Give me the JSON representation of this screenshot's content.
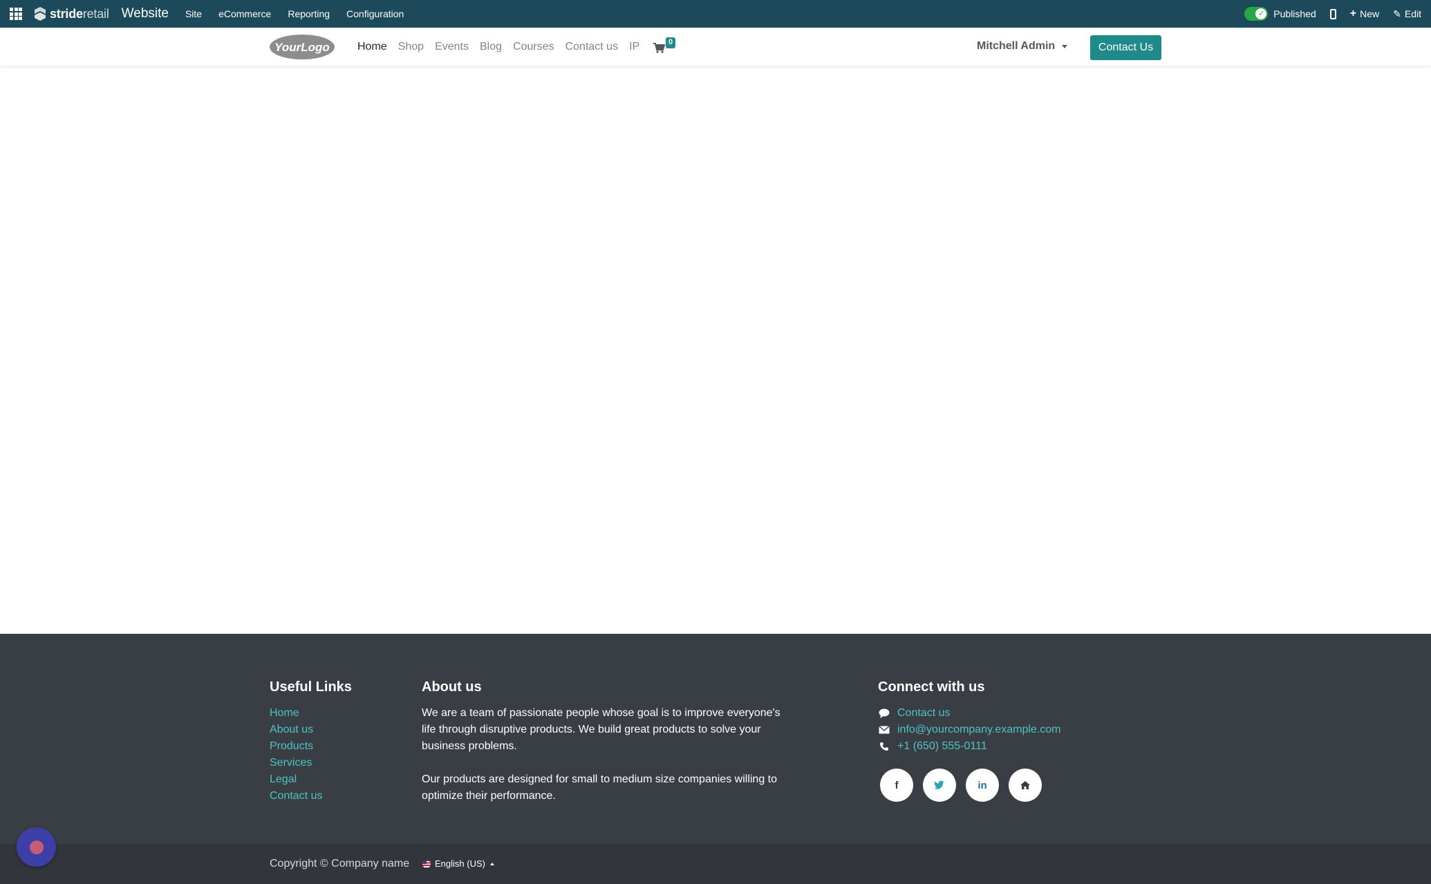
{
  "adminbar": {
    "brand_part1": "stride",
    "brand_part2": "retail",
    "app_name": "Website",
    "menu": [
      "Site",
      "eCommerce",
      "Reporting",
      "Configuration"
    ],
    "published_label": "Published",
    "new_label": "New",
    "edit_label": "Edit"
  },
  "header": {
    "logo_text": "YourLogo",
    "nav": [
      "Home",
      "Shop",
      "Events",
      "Blog",
      "Courses",
      "Contact us",
      "IP"
    ],
    "cart_count": "0",
    "user_name": "Mitchell Admin",
    "contact_button": "Contact Us"
  },
  "footer": {
    "useful_links_title": "Useful Links",
    "useful_links": [
      "Home",
      "About us",
      "Products",
      "Services",
      "Legal",
      "Contact us"
    ],
    "about_title": "About us",
    "about_p1": "We are a team of passionate people whose goal is to improve everyone's life through disruptive products. We build great products to solve your business problems.",
    "about_p2": "Our products are designed for small to medium size companies willing to optimize their performance.",
    "connect_title": "Connect with us",
    "connect_contact": "Contact us",
    "connect_email": "info@yourcompany.example.com",
    "connect_phone": "+1 (650) 555-0111",
    "socials": [
      "facebook-icon",
      "twitter-icon",
      "linkedin-icon",
      "home-icon"
    ]
  },
  "copyright": {
    "text": "Copyright © Company name",
    "language": "English (US)"
  },
  "colors": {
    "adminbar": "#1d4a5a",
    "accent": "#1f8a8a",
    "footer_bg": "#393d44",
    "link": "#4fc3c3"
  }
}
